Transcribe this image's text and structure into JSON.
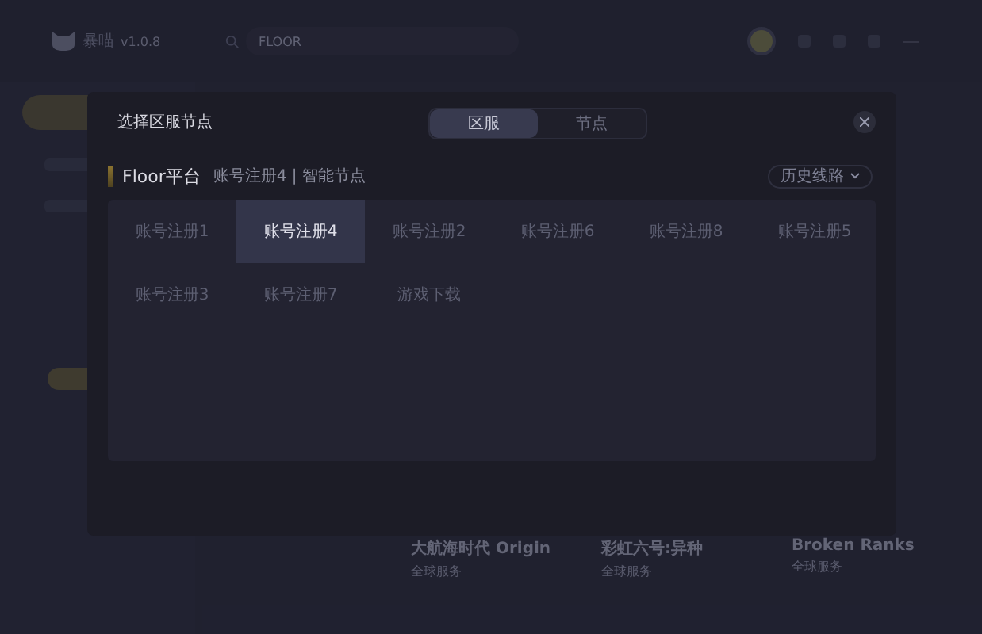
{
  "app": {
    "name": "暴喵",
    "version": "v1.0.8",
    "search": {
      "value": "FLOOR"
    }
  },
  "sidebar": {
    "nav_items": [
      {
        "selected": true
      },
      {
        "selected": false
      },
      {
        "selected": false
      }
    ]
  },
  "games": [
    {
      "title": "大航海时代 Origin",
      "subtitle": "全球服务"
    },
    {
      "title": "彩虹六号:异种",
      "subtitle": "全球服务"
    },
    {
      "title": "Broken Ranks",
      "subtitle": "全球服务"
    }
  ],
  "dialog": {
    "title": "选择区服节点",
    "tabs": [
      {
        "label": "区服",
        "selected": true
      },
      {
        "label": "节点",
        "selected": false
      }
    ],
    "platform": "Floor平台",
    "current": "账号注册4 | 智能节点",
    "history_button": "历史线路",
    "regions": [
      {
        "label": "账号注册1",
        "selected": false
      },
      {
        "label": "账号注册4",
        "selected": true
      },
      {
        "label": "账号注册2",
        "selected": false
      },
      {
        "label": "账号注册6",
        "selected": false
      },
      {
        "label": "账号注册8",
        "selected": false
      },
      {
        "label": "账号注册5",
        "selected": false
      },
      {
        "label": "账号注册3",
        "selected": false
      },
      {
        "label": "账号注册7",
        "selected": false
      },
      {
        "label": "游戏下载",
        "selected": false
      }
    ]
  }
}
